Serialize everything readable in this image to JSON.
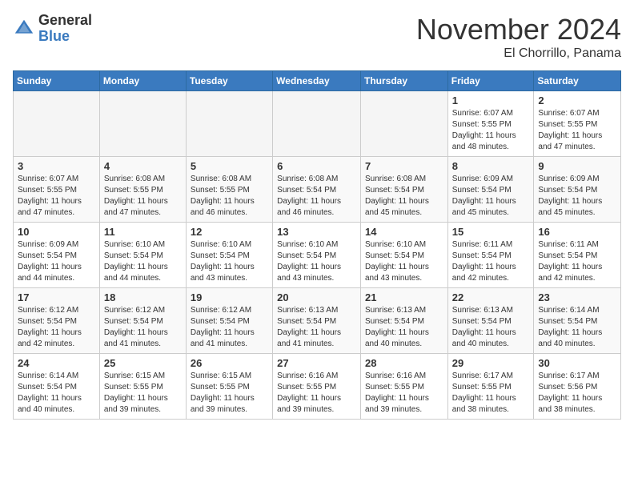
{
  "logo": {
    "general": "General",
    "blue": "Blue"
  },
  "title": "November 2024",
  "location": "El Chorrillo, Panama",
  "weekdays": [
    "Sunday",
    "Monday",
    "Tuesday",
    "Wednesday",
    "Thursday",
    "Friday",
    "Saturday"
  ],
  "weeks": [
    [
      {
        "day": "",
        "info": ""
      },
      {
        "day": "",
        "info": ""
      },
      {
        "day": "",
        "info": ""
      },
      {
        "day": "",
        "info": ""
      },
      {
        "day": "",
        "info": ""
      },
      {
        "day": "1",
        "info": "Sunrise: 6:07 AM\nSunset: 5:55 PM\nDaylight: 11 hours\nand 48 minutes."
      },
      {
        "day": "2",
        "info": "Sunrise: 6:07 AM\nSunset: 5:55 PM\nDaylight: 11 hours\nand 47 minutes."
      }
    ],
    [
      {
        "day": "3",
        "info": "Sunrise: 6:07 AM\nSunset: 5:55 PM\nDaylight: 11 hours\nand 47 minutes."
      },
      {
        "day": "4",
        "info": "Sunrise: 6:08 AM\nSunset: 5:55 PM\nDaylight: 11 hours\nand 47 minutes."
      },
      {
        "day": "5",
        "info": "Sunrise: 6:08 AM\nSunset: 5:55 PM\nDaylight: 11 hours\nand 46 minutes."
      },
      {
        "day": "6",
        "info": "Sunrise: 6:08 AM\nSunset: 5:54 PM\nDaylight: 11 hours\nand 46 minutes."
      },
      {
        "day": "7",
        "info": "Sunrise: 6:08 AM\nSunset: 5:54 PM\nDaylight: 11 hours\nand 45 minutes."
      },
      {
        "day": "8",
        "info": "Sunrise: 6:09 AM\nSunset: 5:54 PM\nDaylight: 11 hours\nand 45 minutes."
      },
      {
        "day": "9",
        "info": "Sunrise: 6:09 AM\nSunset: 5:54 PM\nDaylight: 11 hours\nand 45 minutes."
      }
    ],
    [
      {
        "day": "10",
        "info": "Sunrise: 6:09 AM\nSunset: 5:54 PM\nDaylight: 11 hours\nand 44 minutes."
      },
      {
        "day": "11",
        "info": "Sunrise: 6:10 AM\nSunset: 5:54 PM\nDaylight: 11 hours\nand 44 minutes."
      },
      {
        "day": "12",
        "info": "Sunrise: 6:10 AM\nSunset: 5:54 PM\nDaylight: 11 hours\nand 43 minutes."
      },
      {
        "day": "13",
        "info": "Sunrise: 6:10 AM\nSunset: 5:54 PM\nDaylight: 11 hours\nand 43 minutes."
      },
      {
        "day": "14",
        "info": "Sunrise: 6:10 AM\nSunset: 5:54 PM\nDaylight: 11 hours\nand 43 minutes."
      },
      {
        "day": "15",
        "info": "Sunrise: 6:11 AM\nSunset: 5:54 PM\nDaylight: 11 hours\nand 42 minutes."
      },
      {
        "day": "16",
        "info": "Sunrise: 6:11 AM\nSunset: 5:54 PM\nDaylight: 11 hours\nand 42 minutes."
      }
    ],
    [
      {
        "day": "17",
        "info": "Sunrise: 6:12 AM\nSunset: 5:54 PM\nDaylight: 11 hours\nand 42 minutes."
      },
      {
        "day": "18",
        "info": "Sunrise: 6:12 AM\nSunset: 5:54 PM\nDaylight: 11 hours\nand 41 minutes."
      },
      {
        "day": "19",
        "info": "Sunrise: 6:12 AM\nSunset: 5:54 PM\nDaylight: 11 hours\nand 41 minutes."
      },
      {
        "day": "20",
        "info": "Sunrise: 6:13 AM\nSunset: 5:54 PM\nDaylight: 11 hours\nand 41 minutes."
      },
      {
        "day": "21",
        "info": "Sunrise: 6:13 AM\nSunset: 5:54 PM\nDaylight: 11 hours\nand 40 minutes."
      },
      {
        "day": "22",
        "info": "Sunrise: 6:13 AM\nSunset: 5:54 PM\nDaylight: 11 hours\nand 40 minutes."
      },
      {
        "day": "23",
        "info": "Sunrise: 6:14 AM\nSunset: 5:54 PM\nDaylight: 11 hours\nand 40 minutes."
      }
    ],
    [
      {
        "day": "24",
        "info": "Sunrise: 6:14 AM\nSunset: 5:54 PM\nDaylight: 11 hours\nand 40 minutes."
      },
      {
        "day": "25",
        "info": "Sunrise: 6:15 AM\nSunset: 5:55 PM\nDaylight: 11 hours\nand 39 minutes."
      },
      {
        "day": "26",
        "info": "Sunrise: 6:15 AM\nSunset: 5:55 PM\nDaylight: 11 hours\nand 39 minutes."
      },
      {
        "day": "27",
        "info": "Sunrise: 6:16 AM\nSunset: 5:55 PM\nDaylight: 11 hours\nand 39 minutes."
      },
      {
        "day": "28",
        "info": "Sunrise: 6:16 AM\nSunset: 5:55 PM\nDaylight: 11 hours\nand 39 minutes."
      },
      {
        "day": "29",
        "info": "Sunrise: 6:17 AM\nSunset: 5:55 PM\nDaylight: 11 hours\nand 38 minutes."
      },
      {
        "day": "30",
        "info": "Sunrise: 6:17 AM\nSunset: 5:56 PM\nDaylight: 11 hours\nand 38 minutes."
      }
    ]
  ]
}
